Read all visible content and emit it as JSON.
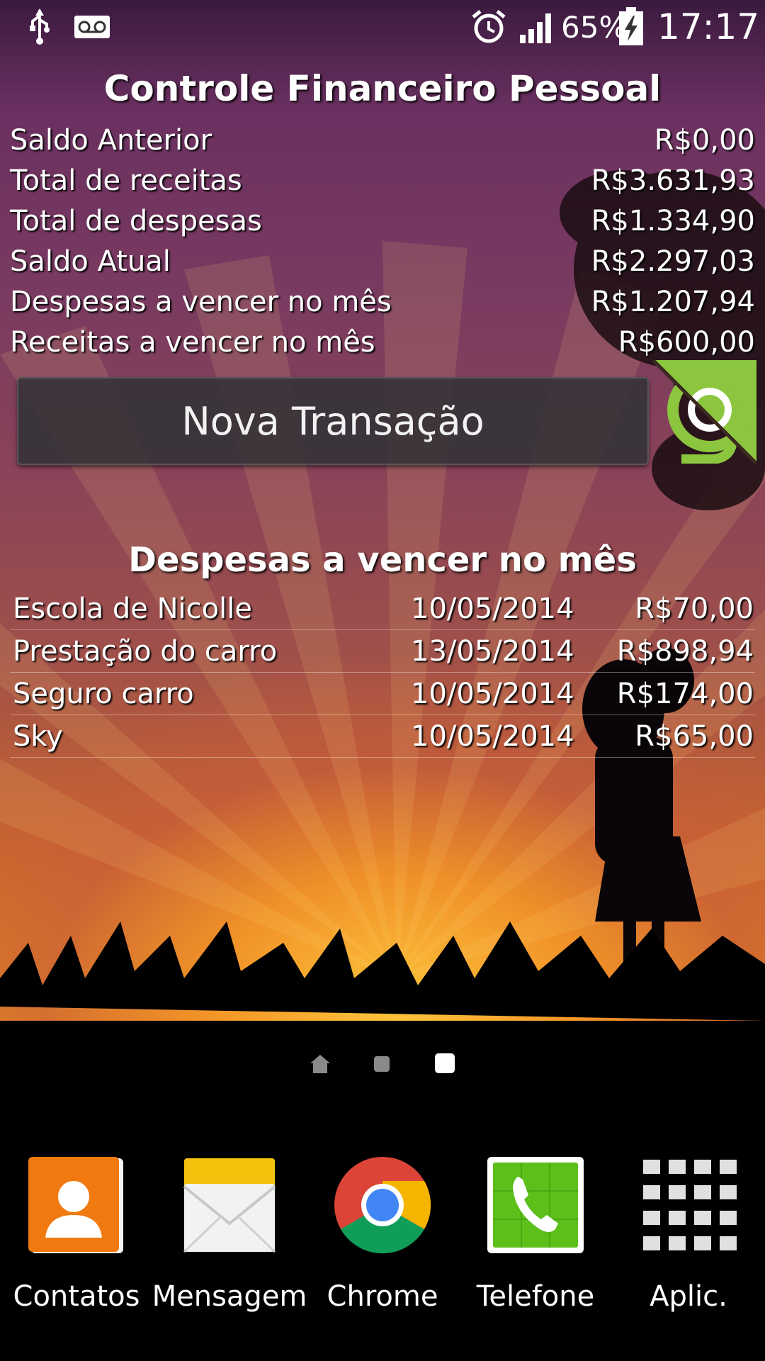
{
  "status_bar": {
    "icons_left": [
      "usb-icon",
      "voicemail-icon"
    ],
    "icons_right": [
      "alarm-icon",
      "signal-icon",
      "battery-charging-icon"
    ],
    "battery": "65%",
    "time": "17:17"
  },
  "widget": {
    "title": "Controle Financeiro Pessoal",
    "summary": [
      {
        "label": "Saldo Anterior",
        "value": "R$0,00"
      },
      {
        "label": "Total de receitas",
        "value": "R$3.631,93"
      },
      {
        "label": "Total de despesas",
        "value": "R$1.334,90"
      },
      {
        "label": "Saldo Atual",
        "value": "R$2.297,03"
      },
      {
        "label": "Despesas a vencer no mês",
        "value": "R$1.207,94"
      },
      {
        "label": "Receitas a vencer no mês",
        "value": "R$600,00"
      }
    ],
    "new_transaction_label": "Nova Transação",
    "expenses_title": "Despesas a vencer no mês",
    "expenses": [
      {
        "name": "Escola de Nicolle",
        "date": "10/05/2014",
        "amount": "R$70,00"
      },
      {
        "name": "Prestação do carro",
        "date": "13/05/2014",
        "amount": "R$898,94"
      },
      {
        "name": "Seguro carro",
        "date": "10/05/2014",
        "amount": "R$174,00"
      },
      {
        "name": "Sky",
        "date": "10/05/2014",
        "amount": "R$65,00"
      }
    ]
  },
  "page_indicator": {
    "pages": 3,
    "current": 3
  },
  "dock": [
    {
      "label": "Contatos",
      "icon": "contacts-icon"
    },
    {
      "label": "Mensagem",
      "icon": "message-icon"
    },
    {
      "label": "Chrome",
      "icon": "chrome-icon"
    },
    {
      "label": "Telefone",
      "icon": "phone-icon"
    },
    {
      "label": "Aplic.",
      "icon": "apps-grid-icon"
    }
  ],
  "colors": {
    "logo_green": "#8cc63f",
    "button_bg": "#323237",
    "contacts_orange": "#f07a10",
    "phone_green": "#5cbf1a"
  }
}
